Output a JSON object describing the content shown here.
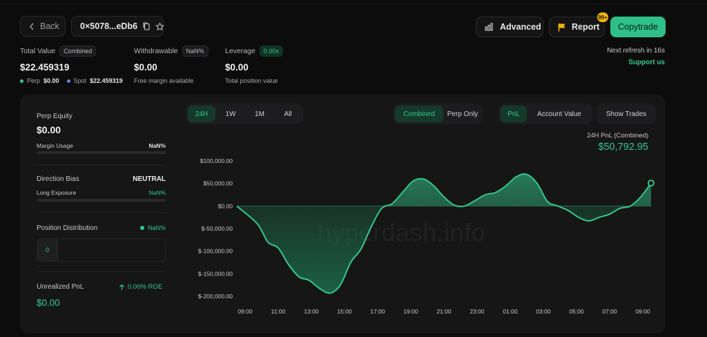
{
  "header": {
    "back_label": "Back",
    "address": "0×5078...eDb6",
    "advanced_label": "Advanced",
    "report_label": "Report",
    "report_badge": "99+",
    "copytrade_label": "Copytrade",
    "refresh_text": "Next refresh in 16s",
    "support_label": "Support us"
  },
  "stats": {
    "total_value": {
      "label": "Total Value",
      "tag": "Combined",
      "value": "$22.459319",
      "perp_label": "Perp",
      "perp_value": "$0.00",
      "spot_label": "Spot",
      "spot_value": "$22.459319"
    },
    "withdrawable": {
      "label": "Withdrawable",
      "tag": "NaN%",
      "value": "$0.00",
      "sub": "Free margin available"
    },
    "leverage": {
      "label": "Leverage",
      "tag": "0.00x",
      "value": "$0.00",
      "sub": "Total position value"
    }
  },
  "left_panel": {
    "perp_equity_label": "Perp Equity",
    "perp_equity_value": "$0.00",
    "margin_usage_label": "Margin Usage",
    "margin_usage_value": "NaN%",
    "direction_bias_label": "Direction Bias",
    "direction_bias_value": "NEUTRAL",
    "long_exposure_label": "Long Exposure",
    "long_exposure_value": "NaN%",
    "position_distribution_label": "Position Distribution",
    "position_distribution_value": "NaN%",
    "distribution_count": "0",
    "unrealized_pnl_label": "Unrealized PnL",
    "roe_value": "0.00% ROE",
    "unrealized_pnl_value": "$0.00"
  },
  "controls": {
    "ranges": [
      "24H",
      "1W",
      "1M",
      "All"
    ],
    "active_range": "24H",
    "modes": [
      "Combined",
      "Perp Only"
    ],
    "active_mode": "Combined",
    "metrics": [
      "PnL",
      "Account Value"
    ],
    "active_metric": "PnL",
    "show_trades_label": "Show Trades"
  },
  "pnl_summary": {
    "label": "24H PnL (Combined)",
    "value": "$50,792.95"
  },
  "watermark": "hyperdash.info",
  "colors": {
    "accent": "#34c98d",
    "button_green": "#2fc089",
    "badge": "#f2b705",
    "background": "#0c0c0d",
    "card": "#161617"
  },
  "chart_data": {
    "type": "area",
    "title": "24H PnL (Combined)",
    "xlabel": "",
    "ylabel": "",
    "x_ticks": [
      "09:00",
      "11:00",
      "13:00",
      "15:00",
      "17:00",
      "19:00",
      "21:00",
      "23:00",
      "01:00",
      "03:00",
      "05:00",
      "07:00",
      "09:00"
    ],
    "y_ticks": [
      "$100,000.00",
      "$50,000.00",
      "$0.00",
      "$-50,000.00",
      "$-100,000.00",
      "$-150,000.00",
      "$-200,000.00"
    ],
    "ylim": [
      -200000,
      100000
    ],
    "x_hours": [
      0,
      1,
      1.5,
      2,
      2.5,
      3,
      3.5,
      4,
      4.5,
      5,
      5.5,
      6,
      6.5,
      7,
      7.5,
      8,
      8.5,
      9,
      9.5,
      10,
      10.5,
      11,
      11.5,
      12,
      12.5,
      13,
      13.5,
      14,
      14.5,
      15,
      15.5,
      16,
      16.5,
      17,
      17.5,
      18,
      18.5,
      19,
      19.5,
      20,
      20.5,
      21,
      21.5,
      22,
      22.5,
      23,
      23.5,
      24,
      24.5,
      25
    ],
    "values": [
      0,
      -40000,
      -80000,
      -93000,
      -130000,
      -157000,
      -165000,
      -183000,
      -193000,
      -175000,
      -125000,
      -95000,
      -45000,
      -5000,
      5000,
      30000,
      55000,
      60000,
      45000,
      20000,
      2000,
      0,
      12000,
      25000,
      30000,
      45000,
      65000,
      70000,
      50000,
      10000,
      0,
      -10000,
      -25000,
      -33000,
      -25000,
      -18000,
      -5000,
      0,
      20000,
      50792.95
    ],
    "grid": false,
    "legend": "none"
  }
}
